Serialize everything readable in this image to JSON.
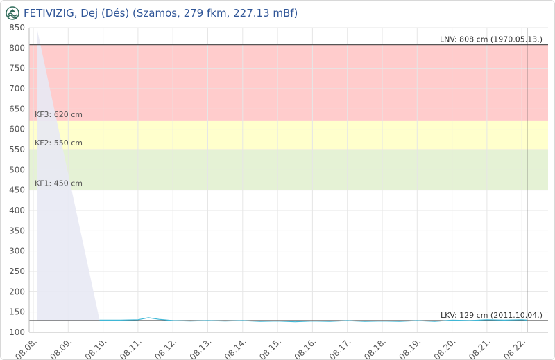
{
  "header": {
    "title": "FETIVIZIG, Dej (Dés) (Szamos, 279 fkm, 227.13 mBf)",
    "logo_icon": "fetivizig-logo-icon"
  },
  "colors": {
    "band_red": "#ffcccc",
    "band_yellow": "#ffffcc",
    "band_green": "#e5f2d5",
    "series_line": "#3fb7d6",
    "ref_line": "#555555",
    "forecast_fill": "#e8e9f4",
    "title": "#2f5597"
  },
  "chart_data": {
    "type": "line",
    "title": "FETIVIZIG, Dej (Dés) (Szamos, 279 fkm, 227.13 mBf)",
    "xlabel": "",
    "ylabel": "",
    "ylim": [
      100,
      850
    ],
    "yticks": [
      100,
      150,
      200,
      250,
      300,
      350,
      400,
      450,
      500,
      550,
      600,
      650,
      700,
      750,
      800,
      850
    ],
    "xticks": [
      "08.08.",
      "08.09.",
      "08.10.",
      "08.11.",
      "08.12.",
      "08.13.",
      "08.14.",
      "08.15.",
      "08.16.",
      "08.17.",
      "08.18.",
      "08.19.",
      "08.20.",
      "08.21.",
      "08.22."
    ],
    "grid": true,
    "bands": [
      {
        "from": 620,
        "to": 808,
        "color": "#ffcccc",
        "label": "KF3: 620 cm"
      },
      {
        "from": 550,
        "to": 620,
        "color": "#ffffcc",
        "label": "KF2: 550 cm"
      },
      {
        "from": 450,
        "to": 550,
        "color": "#e5f2d5",
        "label": "KF1: 450 cm"
      }
    ],
    "reference_lines": [
      {
        "value": 808,
        "label": "LNV: 808 cm (1970.05.13.)"
      },
      {
        "value": 129,
        "label": "LKV: 129 cm (2011.10.04.)"
      }
    ],
    "current_marker_x": 14.15,
    "forecast_shade": {
      "x_start": 0.1,
      "x_end": 1.9,
      "y_top": 850,
      "y_bottom": 130
    },
    "series": [
      {
        "x": [
          1.9,
          2.5,
          3.0,
          3.3,
          3.6,
          4.0,
          4.5,
          5.0,
          5.5,
          6.0,
          6.5,
          7.0,
          7.5,
          8.0,
          8.5,
          9.0,
          9.5,
          10.0,
          10.5,
          11.0,
          11.5,
          12.0,
          12.5,
          13.0,
          13.5,
          14.0,
          14.15
        ],
        "values": [
          130,
          130,
          131,
          136,
          132,
          129,
          128,
          129,
          128,
          129,
          127,
          128,
          126,
          128,
          127,
          129,
          127,
          128,
          127,
          129,
          127,
          130,
          129,
          131,
          130,
          131,
          130
        ]
      }
    ]
  }
}
